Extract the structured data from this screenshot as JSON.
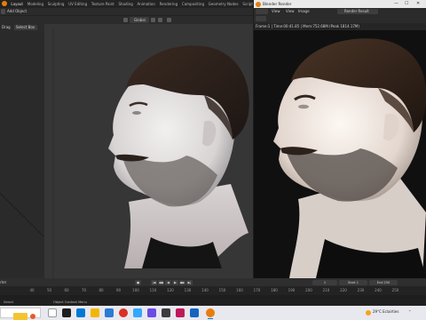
{
  "main_window": {
    "workspace_tabs": [
      "Layout",
      "Modeling",
      "Sculpting",
      "UV Editing",
      "Texture Paint",
      "Shading",
      "Animation",
      "Rendering",
      "Compositing",
      "Geometry Nodes",
      "Scripting"
    ],
    "active_tab": "Layout",
    "header_menus": [
      "Add",
      "Object"
    ],
    "transform_orientation": "Global",
    "tool_header": [
      "Drag",
      "Select Box"
    ]
  },
  "render_window": {
    "title": "Blender Render",
    "menus": [
      "View",
      "View",
      "Image"
    ],
    "slot_label": "Render Result",
    "info_text": "Frame:1 | Time:00:41.85 | Mem:752.68M (Peak 1814.17M)"
  },
  "timeline": {
    "left_label": "rter",
    "ruler_ticks": [
      "40",
      "50",
      "60",
      "70",
      "80",
      "90",
      "100",
      "110",
      "120",
      "130",
      "140",
      "150",
      "160",
      "170",
      "180",
      "190",
      "200",
      "210",
      "220",
      "230",
      "240",
      "250"
    ],
    "current_frame": "1",
    "start_label": "Start",
    "start_value": "1",
    "end_label": "End",
    "end_value": "250"
  },
  "status_bar": {
    "left": "Select",
    "middle": "Object Context Menu",
    "right": ""
  },
  "taskbar": {
    "weather": "29°C  Eclairties",
    "tray_icons": [
      "up-arrow-icon",
      "network-icon",
      "speaker-icon"
    ]
  },
  "colors": {
    "blender_orange": "#e87d0d",
    "accent_blue": "#4a7ab8"
  }
}
